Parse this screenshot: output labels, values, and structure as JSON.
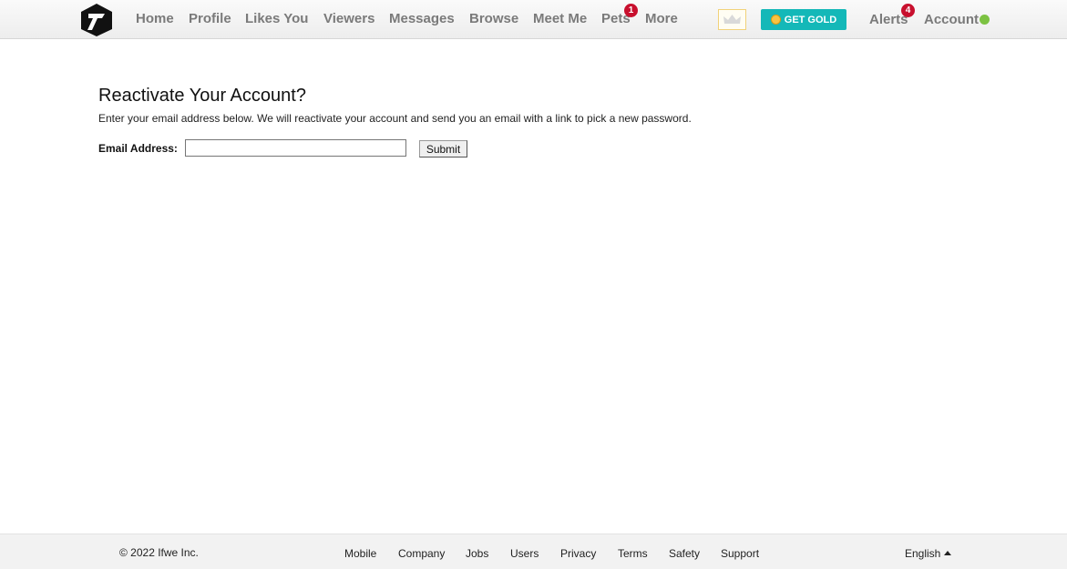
{
  "nav": {
    "items": [
      {
        "label": "Home"
      },
      {
        "label": "Profile"
      },
      {
        "label": "Likes You"
      },
      {
        "label": "Viewers"
      },
      {
        "label": "Messages"
      },
      {
        "label": "Browse"
      },
      {
        "label": "Meet Me"
      },
      {
        "label": "Pets",
        "badge": "1"
      },
      {
        "label": "More"
      }
    ],
    "get_gold_label": "GET GOLD",
    "alerts_label": "Alerts",
    "alerts_badge": "4",
    "account_label": "Account",
    "crown_icon": "crown-icon",
    "coin_icon": "coin-icon",
    "status_color": "#7cc242",
    "gold_color": "#14b8b8"
  },
  "main": {
    "title": "Reactivate Your Account?",
    "instructions": "Enter your email address below. We will reactivate your account and send you an email with a link to pick a new password.",
    "email_label": "Email Address:",
    "email_value": "",
    "submit_label": "Submit"
  },
  "footer": {
    "copyright": "© 2022 Ifwe Inc.",
    "links": [
      "Mobile",
      "Company",
      "Jobs",
      "Users",
      "Privacy",
      "Terms",
      "Safety",
      "Support"
    ],
    "language": "English"
  }
}
